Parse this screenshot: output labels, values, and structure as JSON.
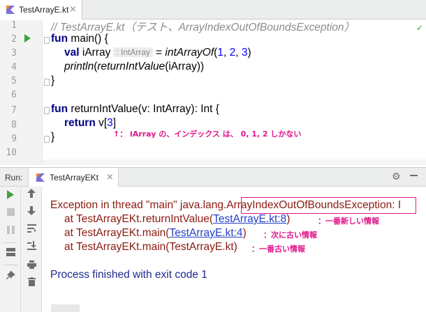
{
  "editor_tab": {
    "filename": "TestArrayE.kt",
    "close_glyph": "×",
    "icon": "kotlin-file-icon"
  },
  "editor": {
    "line_numbers": [
      "1",
      "2",
      "3",
      "4",
      "5",
      "6",
      "7",
      "8",
      "9",
      "10"
    ],
    "line1_comment": "// TestArrayE.kt（テスト、ArrayIndexOutOfBoundsException）",
    "line2_kw": "fun",
    "line2_rest": " main() {",
    "line3_kw": "val",
    "line3_name": " iArray",
    "line3_hint": ": IntArray",
    "line3_eq": "= ",
    "line3_fn": "intArrayOf",
    "line3_open": "(",
    "line3_n1": "1",
    "line3_c1": ", ",
    "line3_n2": "2",
    "line3_c2": ", ",
    "line3_n3": "3",
    "line3_close": ")",
    "line4_fn": "println",
    "line4_open": "(",
    "line4_fn2": "returnIntValue",
    "line4_rest": "(iArray))",
    "line5": "}",
    "line7_kw": "fun",
    "line7_rest": " returnIntValue(v: IntArray): Int {",
    "line8_kw": "return",
    "line8_v": " v[",
    "line8_n": "3",
    "line8_close": "]",
    "line9": "}",
    "annotation": "↑： iArray の、インデックス は、 0, 1, 2 しかない",
    "status_check": "✓"
  },
  "run_window": {
    "title": "Run:",
    "tab_label": "TestArrayEKt",
    "close_glyph": "×",
    "toolbar_left": [
      "rerun-icon",
      "stop-icon",
      "pause-icon",
      "layout-icon",
      "pin-icon"
    ],
    "toolbar_right": [
      "up-arrow-icon",
      "down-arrow-icon",
      "soft-wrap-icon",
      "scroll-to-end-icon",
      "print-icon",
      "trash-icon"
    ]
  },
  "console": {
    "exc_prefix": "Exception in thread \"main\" java.lang.",
    "exc_name": "ArrayIndexOutOfBoundsException",
    "exc_suffix": ": I",
    "stack": [
      {
        "prefix": "at TestArrayEKt.returnIntValue(",
        "link": "TestArrayE.kt:8",
        "suffix": ")",
        "annotation": "：一番新しい情報"
      },
      {
        "prefix": "at TestArrayEKt.main(",
        "link": "TestArrayE.kt:4",
        "suffix": ")",
        "annotation": "：次に古い情報"
      },
      {
        "prefix": "at TestArrayEKt.main(TestArrayE.kt)",
        "link": "",
        "suffix": "",
        "annotation": "：一番古い情報"
      }
    ],
    "process_line": "Process finished with exit code 1"
  },
  "colors": {
    "keyword": "#000080",
    "number": "#0000ff",
    "comment": "#8c8c8c",
    "error_text": "#8b1a10",
    "link": "#2340c8",
    "annotation": "#e0158a",
    "run_green": "#3ea33e"
  }
}
